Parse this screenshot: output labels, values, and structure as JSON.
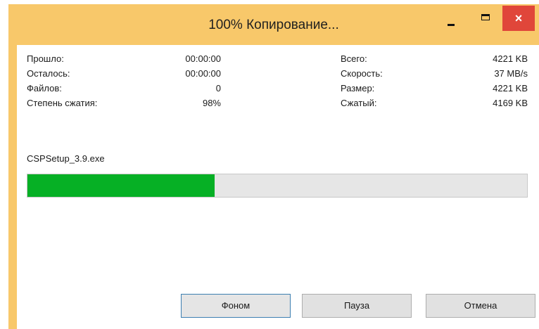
{
  "window": {
    "title": "100% Копирование...",
    "close_glyph": "×",
    "title_bar_color": "#f8c86a",
    "close_color": "#e0463a",
    "icons": [
      "minimize-icon",
      "maximize-icon",
      "close-icon"
    ]
  },
  "stats_left": [
    {
      "label": "Прошло:",
      "value": "00:00:00"
    },
    {
      "label": "Осталось:",
      "value": "00:00:00"
    },
    {
      "label": "Файлов:",
      "value": "0"
    },
    {
      "label": "Степень сжатия:",
      "value": "98%"
    }
  ],
  "stats_right": [
    {
      "label": "Всего:",
      "value": "4221 KB"
    },
    {
      "label": "Скорость:",
      "value": "37 MB/s"
    },
    {
      "label": "Размер:",
      "value": "4221 KB"
    },
    {
      "label": "Сжатый:",
      "value": "4169 KB"
    }
  ],
  "current_file": "CSPSetup_3.9.exe",
  "progress": {
    "fraction": 0.375,
    "fill_color": "#06b025"
  },
  "buttons": {
    "background": "Фоном",
    "pause": "Пауза",
    "cancel": "Отмена"
  }
}
